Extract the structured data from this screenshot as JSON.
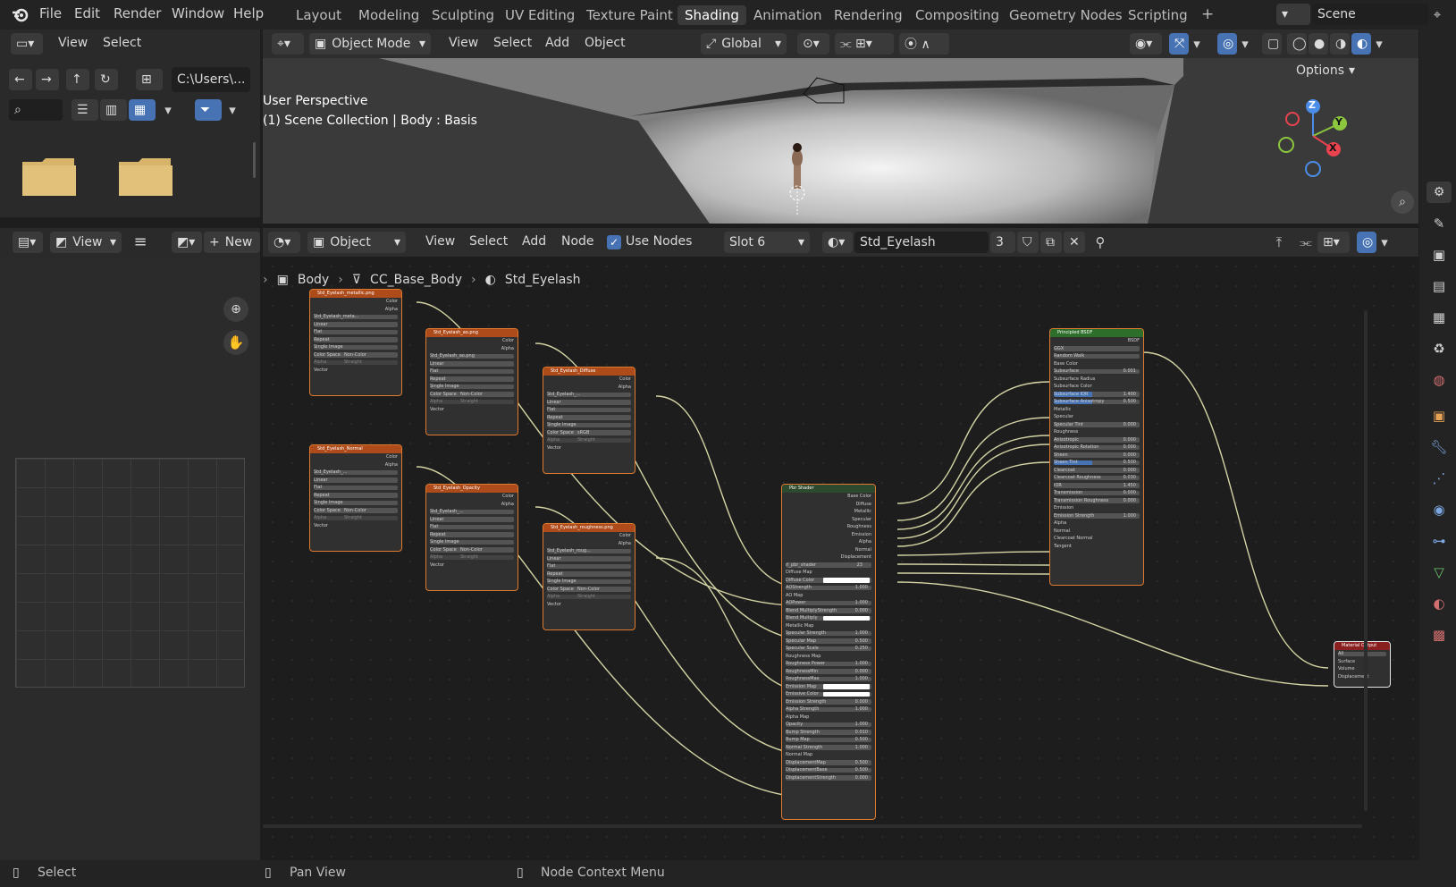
{
  "topbar": {
    "menus": [
      "File",
      "Edit",
      "Render",
      "Window",
      "Help"
    ],
    "workspaces": [
      "Layout",
      "Modeling",
      "Sculpting",
      "UV Editing",
      "Texture Paint",
      "Shading",
      "Animation",
      "Rendering",
      "Compositing",
      "Geometry Nodes",
      "Scripting"
    ],
    "active_workspace": "Shading",
    "add_tab": "+",
    "scene": "Scene"
  },
  "filebrowser": {
    "view": "View",
    "select": "Select",
    "path": "C:\\Users\\..."
  },
  "viewport": {
    "mode": "Object Mode",
    "menus": [
      "View",
      "Select",
      "Add",
      "Object"
    ],
    "orientation": "Global",
    "options": "Options",
    "overlay_line1": "User Perspective",
    "overlay_line2": "(1) Scene Collection | Body : Basis",
    "gizmo": {
      "z": "Z",
      "y": "Y",
      "x": "X"
    }
  },
  "imageeditor": {
    "view": "View",
    "new": "New"
  },
  "nodeeditor": {
    "object_type": "Object",
    "menus": [
      "View",
      "Select",
      "Add",
      "Node"
    ],
    "use_nodes": "Use Nodes",
    "slot": "Slot 6",
    "material": "Std_Eyelash",
    "users": "3",
    "breadcrumb": [
      "Body",
      "CC_Base_Body",
      "Std_Eyelash"
    ]
  },
  "nodes": {
    "img1": {
      "title": "Std_Eyelash_metallic.png",
      "image": "Std_Eyelash_meta...",
      "outputs": [
        "Color",
        "Alpha"
      ],
      "interp": "Linear",
      "proj": "Flat",
      "ext": "Repeat",
      "src": "Single Image",
      "cs_label": "Color Space",
      "cs": "Non-Color",
      "alpha_label": "Alpha",
      "alpha": "Straight",
      "vector": "Vector"
    },
    "img2": {
      "title": "Std_Eyelash_ao.png",
      "image": "Std_Eyelash_ao.png",
      "outputs": [
        "Color",
        "Alpha"
      ],
      "interp": "Linear",
      "proj": "Flat",
      "ext": "Repeat",
      "src": "Single Image",
      "cs_label": "Color Space",
      "cs": "Non-Color",
      "alpha_label": "Alpha",
      "alpha": "Straight",
      "vector": "Vector"
    },
    "img3": {
      "title": "Std_Eyelash_Diffuse",
      "image": "Std_Eyelash_...",
      "users": "2",
      "outputs": [
        "Color",
        "Alpha"
      ],
      "interp": "Linear",
      "proj": "Flat",
      "ext": "Repeat",
      "src": "Single Image",
      "cs_label": "Color Space",
      "cs": "sRGB",
      "alpha_label": "Alpha",
      "alpha": "Straight",
      "vector": "Vector"
    },
    "img4": {
      "title": "Std_Eyelash_Normal",
      "image": "Std_Eyelash_...",
      "users": "2",
      "outputs": [
        "Color",
        "Alpha"
      ],
      "interp": "Linear",
      "proj": "Flat",
      "ext": "Repeat",
      "src": "Single Image",
      "cs_label": "Color Space",
      "cs": "Non-Color",
      "alpha_label": "Alpha",
      "alpha": "Straight",
      "vector": "Vector"
    },
    "img5": {
      "title": "Std_Eyelash_Opacity",
      "image": "Std_Eyelash_...",
      "users": "2",
      "outputs": [
        "Color",
        "Alpha"
      ],
      "interp": "Linear",
      "proj": "Flat",
      "ext": "Repeat",
      "src": "Single Image",
      "cs_label": "Color Space",
      "cs": "Non-Color",
      "alpha_label": "Alpha",
      "alpha": "Straight",
      "vector": "Vector"
    },
    "img6": {
      "title": "Std_Eyelash_roughness.png",
      "image": "Std_Eyelash_roug...",
      "outputs": [
        "Color",
        "Alpha"
      ],
      "interp": "Linear",
      "proj": "Flat",
      "ext": "Repeat",
      "src": "Single Image",
      "cs_label": "Color Space",
      "cs": "Non-Color",
      "alpha_label": "Alpha",
      "alpha": "Straight",
      "vector": "Vector"
    },
    "group": {
      "title": "Pbr Shader",
      "outputs": [
        "Base Color",
        "Diffuse",
        "Metallic",
        "Specular",
        "Roughness",
        "Emission",
        "Alpha",
        "Normal",
        "Displacement"
      ],
      "datablock": "rl_pbr_shader",
      "users": "23",
      "inputs": [
        {
          "l": "Diffuse Map"
        },
        {
          "l": "Diffuse Color",
          "c": "#ffffff"
        },
        {
          "l": "AOStrength",
          "v": "1.000"
        },
        {
          "l": "AO Map"
        },
        {
          "l": "AOPower",
          "v": "1.000"
        },
        {
          "l": "Blend MultiplyStrength",
          "v": "0.000"
        },
        {
          "l": "Blend Multiply",
          "c": "#ffffff"
        },
        {
          "l": "Metallic Map"
        },
        {
          "l": "Specular Strength",
          "v": "1.000"
        },
        {
          "l": "Specular Map",
          "v": "0.500"
        },
        {
          "l": "Specular Scale",
          "v": "0.250"
        },
        {
          "l": "Roughness Map"
        },
        {
          "l": "Roughness Power",
          "v": "1.000"
        },
        {
          "l": "RoughnessMin",
          "v": "0.000"
        },
        {
          "l": "RoughnessMax",
          "v": "1.000"
        },
        {
          "l": "Emission Map",
          "c": "#ffffff"
        },
        {
          "l": "Emissive Color",
          "c": "#ffffff"
        },
        {
          "l": "Emission Strength",
          "v": "0.000"
        },
        {
          "l": "Alpha Strength",
          "v": "1.000"
        },
        {
          "l": "Alpha Map"
        },
        {
          "l": "Opacity",
          "v": "1.000"
        },
        {
          "l": "Bump Strength",
          "v": "0.010"
        },
        {
          "l": "Bump Map",
          "v": "0.500"
        },
        {
          "l": "Normal Strength",
          "v": "1.000"
        },
        {
          "l": "Normal Map"
        },
        {
          "l": "DisplacementMap",
          "v": "0.500"
        },
        {
          "l": "DisplacementBase",
          "v": "0.500"
        },
        {
          "l": "DisplacementStrength",
          "v": "0.000"
        }
      ]
    },
    "bsdf": {
      "title": "Principled BSDF",
      "output": "BSDF",
      "dist": "GGX",
      "ss": "Random Walk",
      "rows": [
        {
          "l": "Base Color"
        },
        {
          "l": "Subsurface",
          "v": "0.001"
        },
        {
          "l": "Subsurface Radius"
        },
        {
          "l": "Subsurface Color"
        },
        {
          "l": "Subsurface IOR",
          "v": "1.400",
          "hl": true
        },
        {
          "l": "Subsurface Anisotropy",
          "v": "0.500",
          "hl": true
        },
        {
          "l": "Metallic"
        },
        {
          "l": "Specular"
        },
        {
          "l": "Specular Tint",
          "v": "0.000"
        },
        {
          "l": "Roughness"
        },
        {
          "l": "Anisotropic",
          "v": "0.000"
        },
        {
          "l": "Anisotropic Rotation",
          "v": "0.000"
        },
        {
          "l": "Sheen",
          "v": "0.000"
        },
        {
          "l": "Sheen Tint",
          "v": "0.500",
          "hl": true
        },
        {
          "l": "Clearcoat",
          "v": "0.000"
        },
        {
          "l": "Clearcoat Roughness",
          "v": "0.030"
        },
        {
          "l": "IOR",
          "v": "1.450"
        },
        {
          "l": "Transmission",
          "v": "0.000"
        },
        {
          "l": "Transmission Roughness",
          "v": "0.000"
        },
        {
          "l": "Emission"
        },
        {
          "l": "Emission Strength",
          "v": "1.000"
        },
        {
          "l": "Alpha"
        },
        {
          "l": "Normal"
        },
        {
          "l": "Clearcoat Normal"
        },
        {
          "l": "Tangent"
        }
      ]
    },
    "output": {
      "title": "Material Output",
      "target": "All",
      "rows": [
        "Surface",
        "Volume",
        "Displacement"
      ]
    }
  },
  "statusbar": {
    "left": "Select",
    "mid": "Pan View",
    "right": "Node Context Menu"
  },
  "colors": {
    "accent": "#4772b3",
    "texture_header": "#ae4b1b",
    "shader_header": "#2d6e2a",
    "output_header": "#8a1f1f",
    "group_header": "#2e4a2e",
    "link": "#d4d4a5"
  }
}
